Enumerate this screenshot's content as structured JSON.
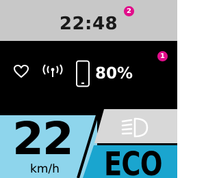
{
  "header": {
    "time": "22:48",
    "badge_number": "2"
  },
  "status": {
    "badge_number": "1",
    "battery_percent": "80%",
    "icons": [
      "heart-icon",
      "wireless-signal-icon",
      "phone-icon"
    ]
  },
  "speed": {
    "value": "22",
    "unit": "km/h"
  },
  "assist": {
    "mode": "ECO",
    "light_icon": "headlight-icon"
  },
  "colors": {
    "top_bar": "#c8c8c8",
    "background": "#000000",
    "speed_panel": "#8ed5ec",
    "mode_panel": "#1aa5cf",
    "light_panel": "#d8d8d8",
    "badge": "#e10d8a",
    "text_light": "#ffffff"
  }
}
